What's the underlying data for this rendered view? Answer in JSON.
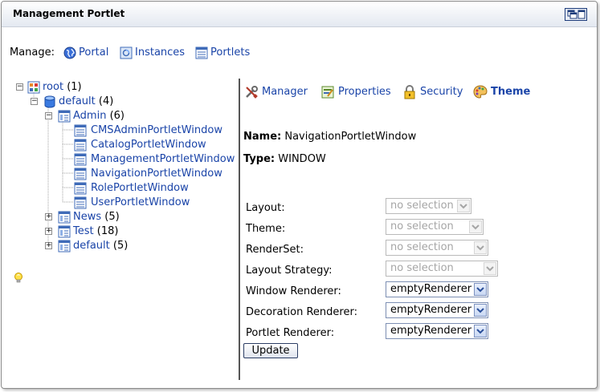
{
  "title": "Management Portlet",
  "manage": {
    "label": "Manage:",
    "links": [
      {
        "label": "Portal",
        "icon": "globe-icon"
      },
      {
        "label": "Instances",
        "icon": "instances-icon"
      },
      {
        "label": "Portlets",
        "icon": "portlets-icon"
      }
    ]
  },
  "tree": {
    "root": {
      "label": "root",
      "count": "(1)"
    },
    "default": {
      "label": "default",
      "count": "(4)"
    },
    "admin": {
      "label": "Admin",
      "count": "(6)"
    },
    "windows": [
      "CMSAdminPortletWindow",
      "CatalogPortletWindow",
      "ManagementPortletWindow",
      "NavigationPortletWindow",
      "RolePortletWindow",
      "UserPortletWindow"
    ],
    "news": {
      "label": "News",
      "count": "(5)"
    },
    "test": {
      "label": "Test",
      "count": "(18)"
    },
    "default2": {
      "label": "default",
      "count": "(5)"
    }
  },
  "tabs": [
    {
      "label": "Manager",
      "icon": "tools-icon"
    },
    {
      "label": "Properties",
      "icon": "properties-icon"
    },
    {
      "label": "Security",
      "icon": "lock-icon"
    },
    {
      "label": "Theme",
      "icon": "palette-icon",
      "active": true
    }
  ],
  "info": {
    "name_label": "Name:",
    "name_value": "NavigationPortletWindow",
    "type_label": "Type:",
    "type_value": "WINDOW"
  },
  "form": {
    "layout": {
      "label": "Layout:",
      "value": "no selection"
    },
    "theme": {
      "label": "Theme:",
      "value": "no selection"
    },
    "renderset": {
      "label": "RenderSet:",
      "value": "no selection"
    },
    "strategy": {
      "label": "Layout Strategy:",
      "value": "no selection"
    },
    "window_renderer": {
      "label": "Window Renderer:",
      "value": "emptyRenderer"
    },
    "decoration_renderer": {
      "label": "Decoration Renderer:",
      "value": "emptyRenderer"
    },
    "portlet_renderer": {
      "label": "Portlet Renderer:",
      "value": "emptyRenderer"
    },
    "update_label": "Update"
  },
  "colors": {
    "link": "#1a44a8",
    "title_bar_top": "#ffffff",
    "title_bar_bottom": "#e4e9f1",
    "divider": "#555555"
  }
}
